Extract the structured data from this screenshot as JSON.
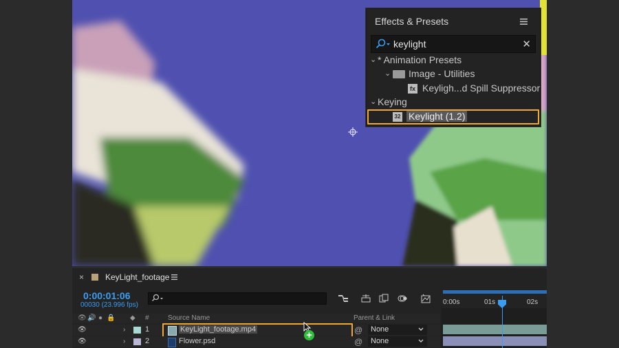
{
  "effects_panel": {
    "title": "Effects & Presets",
    "search_value": "keylight",
    "tree": {
      "animation_presets": "* Animation Presets",
      "image_utilities": "Image - Utilities",
      "spill_suppressor": "Keyligh...d Spill Suppressor",
      "keying": "Keying",
      "keylight_effect": "Keylight (1.2)",
      "keylight_badge": "32"
    }
  },
  "timeline": {
    "comp_name": "KeyLight_footage",
    "timecode": "0:00:01:06",
    "frame_fps": "00030 (23.996 fps)",
    "columns": {
      "number": "#",
      "source_name": "Source Name",
      "parent_link": "Parent & Link"
    },
    "layers": [
      {
        "num": "1",
        "name": "KeyLight_footage.mp4",
        "parent": "None",
        "label_color": "#a8d8cf"
      },
      {
        "num": "2",
        "name": "Flower.psd",
        "parent": "None",
        "label_color": "#b9b6d6"
      }
    ],
    "ruler": [
      "0:00s",
      "01s",
      "02s"
    ]
  },
  "colors": {
    "accent_blue": "#3b9cf0",
    "highlight_orange": "#f0a830",
    "backdrop_blue": "#4f50b0"
  }
}
